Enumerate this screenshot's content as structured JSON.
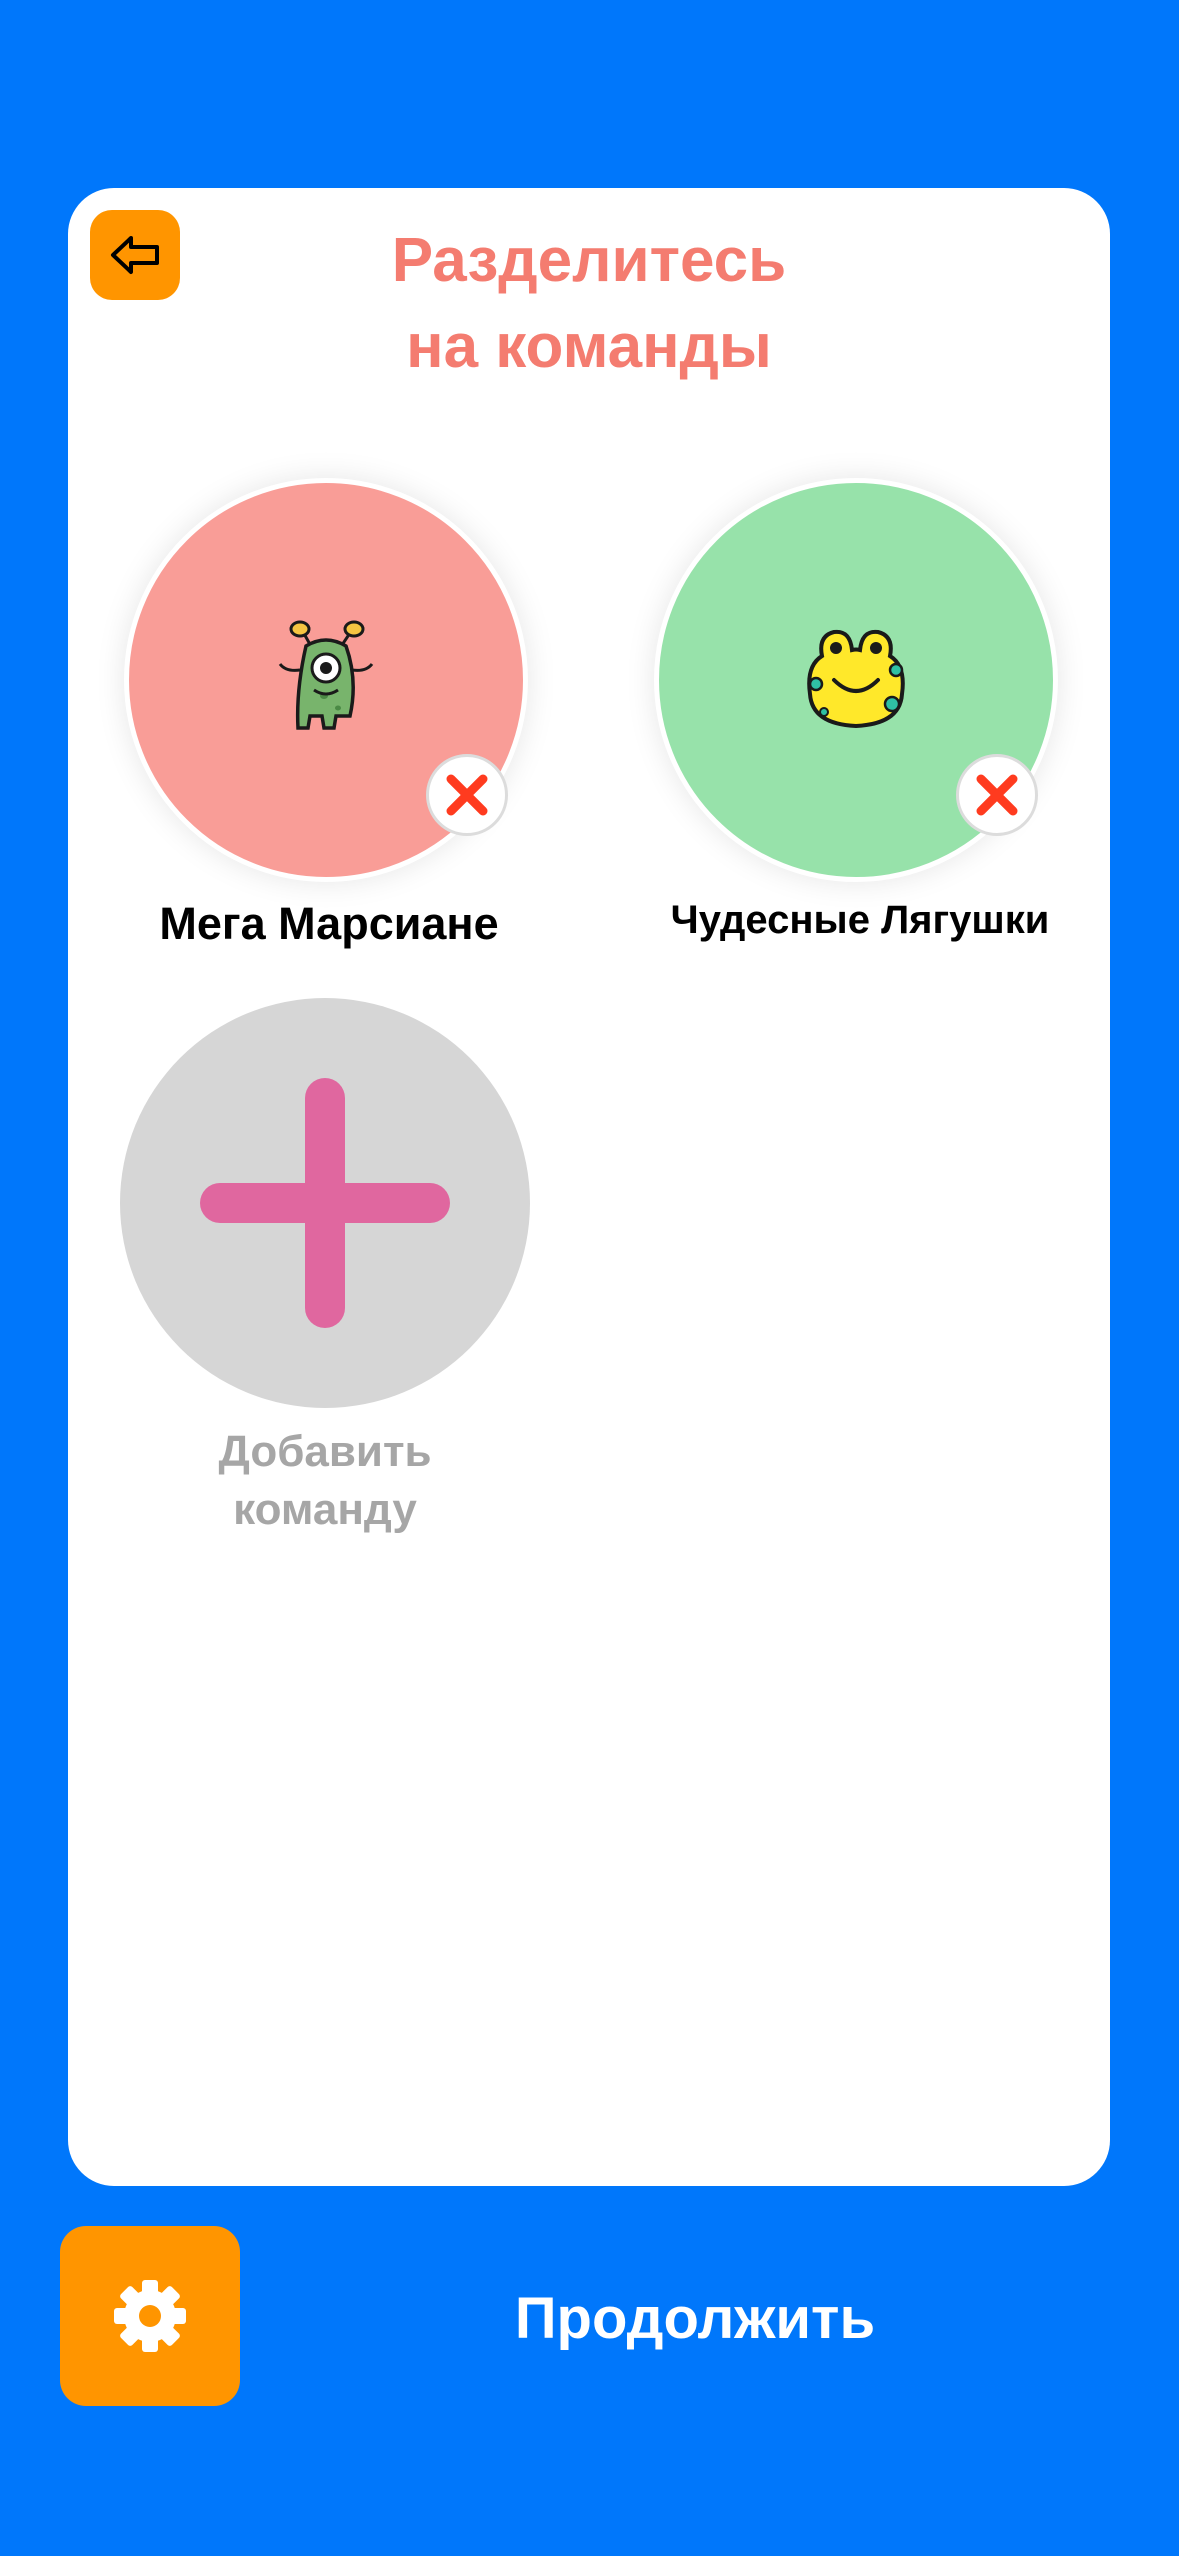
{
  "header": {
    "title": "Разделитесь\nна команды",
    "back_icon": "arrow-left-icon"
  },
  "teams": [
    {
      "name": "Мега Марсиане",
      "avatar": "martian-icon",
      "color": "#f99d97"
    },
    {
      "name": "Чудесные Лягушки",
      "avatar": "frog-icon",
      "color": "#97e2aa"
    }
  ],
  "add_team": {
    "label": "Добавить\nкоманду",
    "icon": "plus-icon"
  },
  "footer": {
    "settings_icon": "gear-icon",
    "continue_label": "Продолжить"
  },
  "colors": {
    "background": "#0077fb",
    "accent": "#ff9500",
    "title": "#f47c70",
    "plus": "#e0679f",
    "remove": "#ff3b1f"
  }
}
